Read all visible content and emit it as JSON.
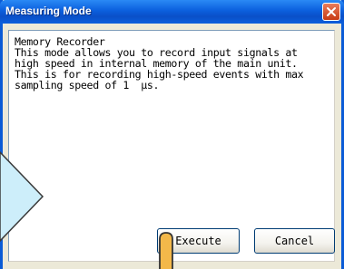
{
  "window": {
    "title": "Measuring Mode",
    "close_icon": "close-icon",
    "colors": {
      "titlebar": "#0b5fdd",
      "close": "#c83b14",
      "callout": "#cdeefa",
      "pointer": "#f3b84a"
    }
  },
  "description": {
    "lines": [
      "Memory Recorder",
      "This mode allows you to record input signals at",
      "high speed in internal memory of the main unit.",
      "This is for recording high-speed events with max",
      "sampling speed of 1  µs."
    ]
  },
  "buttons": {
    "execute": "Execute",
    "cancel": "Cancel"
  },
  "annotation": {
    "pointer_icon": "hand-pointer-icon",
    "callout_icon": "callout-arrow-icon"
  }
}
